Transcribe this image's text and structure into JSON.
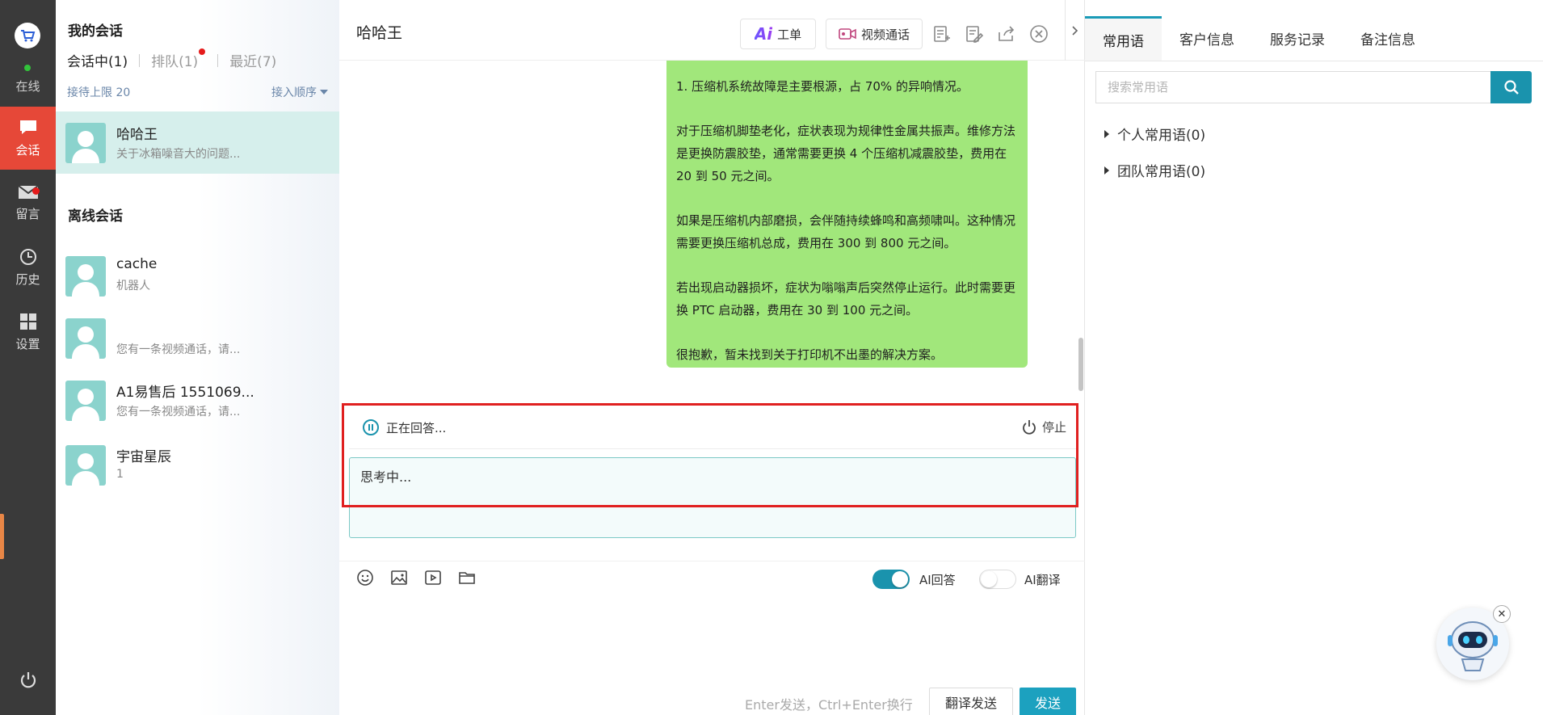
{
  "rail": {
    "status": "在线",
    "items": [
      {
        "label": "会话",
        "icon": "chat-icon"
      },
      {
        "label": "留言",
        "icon": "mail-icon"
      },
      {
        "label": "历史",
        "icon": "clock-icon"
      },
      {
        "label": "设置",
        "icon": "grid-icon"
      }
    ],
    "accent": "#e64838"
  },
  "list": {
    "my_title": "我的会话",
    "tabs": [
      "会话中(1)",
      "排队(1)",
      "最近(7)"
    ],
    "limit_text": "接待上限 20",
    "sort_text": "接入顺序",
    "active_conv": {
      "name": "哈哈王",
      "preview": "关于冰箱噪音大的问题..."
    },
    "offline_title": "离线会话",
    "offline": [
      {
        "name": "cache",
        "preview": "机器人"
      },
      {
        "name": "",
        "preview": "您有一条视频通话，请..."
      },
      {
        "name": "A1易售后 1551069...",
        "preview": "您有一条视频通话，请..."
      },
      {
        "name": "宇宙星辰",
        "preview": "1"
      }
    ]
  },
  "chat": {
    "title": "哈哈王",
    "btn_ticket": "工单",
    "btn_ticket_ai": "Ai",
    "btn_video": "视频通话",
    "message_paragraphs": [
      "1. 压缩机系统故障是主要根源，占 70% 的异响情况。",
      "对于压缩机脚垫老化，症状表现为规律性金属共振声。维修方法是更换防震胶垫，通常需要更换 4 个压缩机减震胶垫，费用在 20 到 50 元之间。",
      "如果是压缩机内部磨损，会伴随持续蜂鸣和高频啸叫。这种情况需要更换压缩机总成，费用在 300 到 800 元之间。",
      "若出现启动器损坏，症状为嗡嗡声后突然停止运行。此时需要更换 PTC 启动器，费用在 30 到 100 元之间。",
      "很抱歉，暂未找到关于打印机不出墨的解决方案。"
    ],
    "answering_text": "正在回答...",
    "stop_label": "停止",
    "input_value": "思考中...",
    "ai_reply_label": "AI回答",
    "ai_reply_on": true,
    "ai_translate_label": "AI翻译",
    "ai_translate_on": false,
    "send_hint": "Enter发送，Ctrl+Enter换行",
    "btn_translate_send": "翻译发送",
    "btn_send": "发送",
    "bubble_color": "#a1e77b",
    "send_color": "#1ca1bf"
  },
  "right": {
    "tabs": [
      "常用语",
      "客户信息",
      "服务记录",
      "备注信息"
    ],
    "search_placeholder": "搜索常用语",
    "groups": [
      "个人常用语(0)",
      "团队常用语(0)"
    ]
  }
}
